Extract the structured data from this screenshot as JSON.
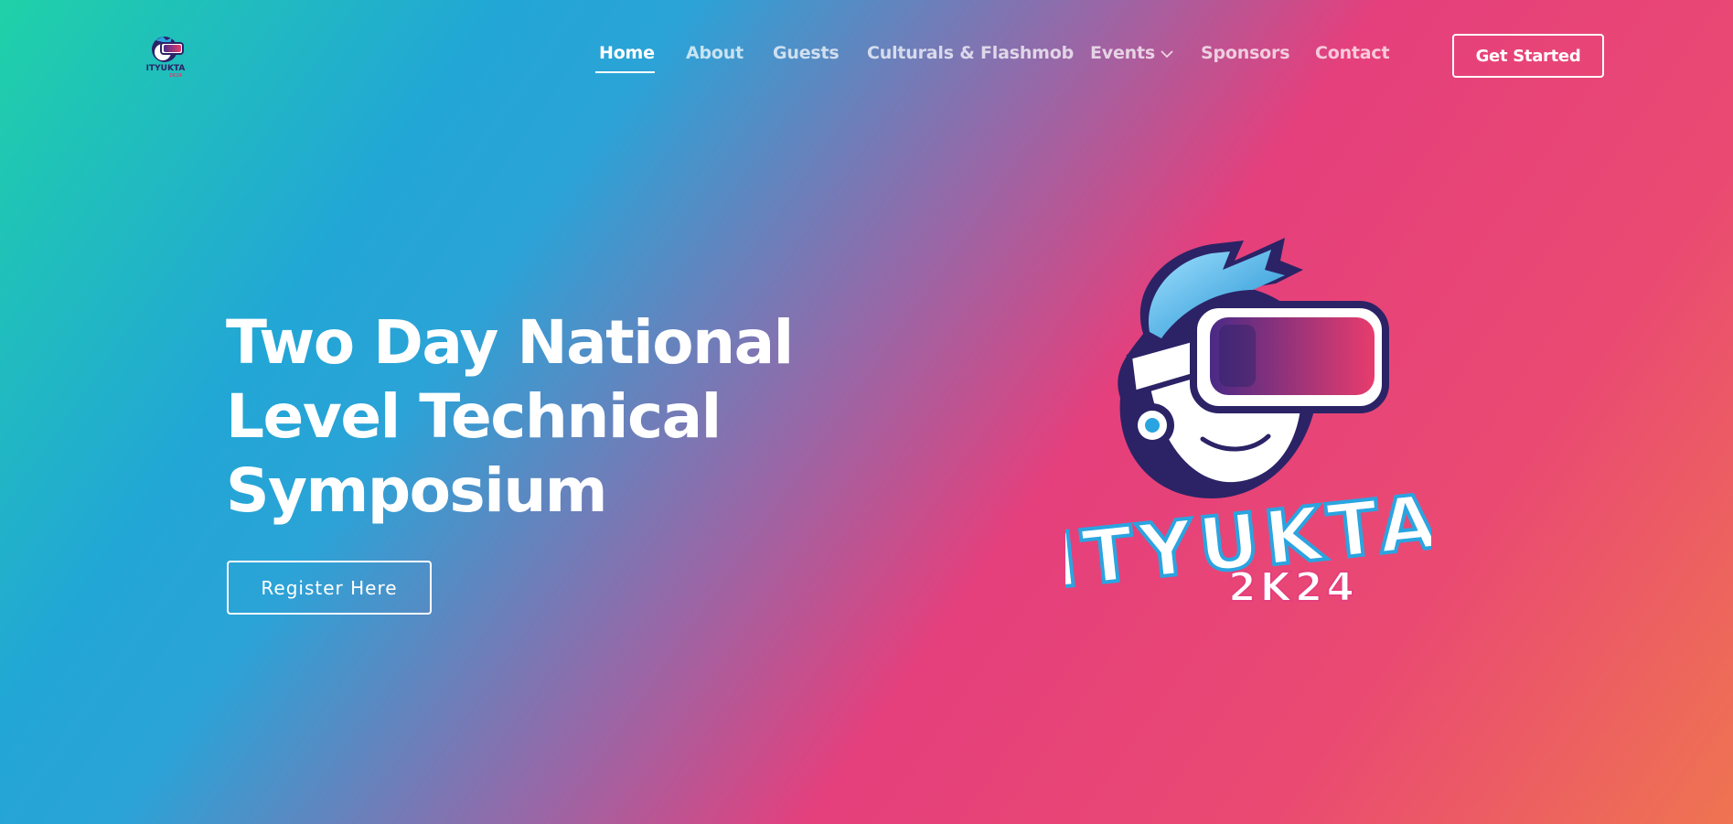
{
  "brand": {
    "small_logo_name": "ITYUKTA",
    "small_logo_sub": "2K24",
    "hero_logo_name": "ITYUKTA",
    "hero_logo_sub": "2K24"
  },
  "nav": {
    "items": [
      {
        "label": "Home",
        "active": true
      },
      {
        "label": "About"
      },
      {
        "label": "Guests"
      },
      {
        "label": "Culturals & Flashmob"
      },
      {
        "label": "Events",
        "icon": "chevron-down-icon"
      },
      {
        "label": "Sponsors"
      },
      {
        "label": "Contact"
      }
    ],
    "cta_label": "Get Started"
  },
  "hero": {
    "title_line1": "Two Day National",
    "title_line2": "Level Technical",
    "title_line3": "Symposium",
    "register_label": "Register Here"
  },
  "colors": {
    "gradient": [
      "#1fd1a8",
      "#22a6d6",
      "#9a66a6",
      "#e53f7c",
      "#ef7451"
    ],
    "logo_outline": "#2b2366",
    "goggle_gradient": [
      "#4a2a86",
      "#e83c6d"
    ],
    "hair_blue": "#2aa4e0"
  }
}
